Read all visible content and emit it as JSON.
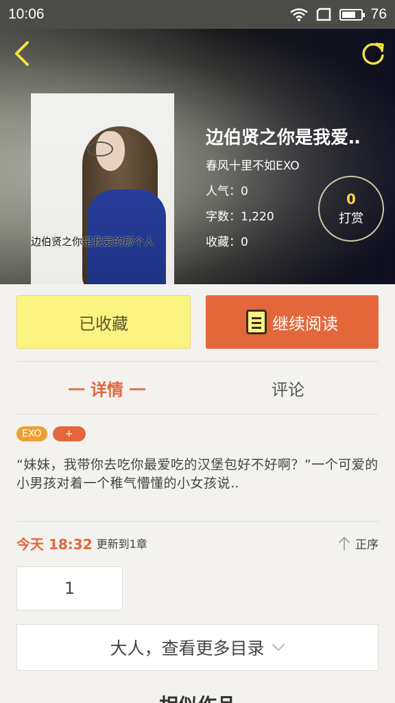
{
  "status_bar": {
    "time": "10:06",
    "battery": "76"
  },
  "hero": {
    "cover_text": "边伯贤之你是我爱的那个人",
    "title": "边伯贤之你是我爱‥",
    "author": "春风十里不如EXO",
    "popularity": "人气：0",
    "word_count": "字数：1,220",
    "favorites": "收藏：0",
    "tip_count": "0",
    "tip_label": "打赏"
  },
  "actions": {
    "favorited_label": "已收藏",
    "continue_label": "继续阅读"
  },
  "tabs": {
    "detail": "一 详情 一",
    "comments": "评论"
  },
  "tags": [
    "EXO",
    "+"
  ],
  "description": "“妹妹，我带你去吃你最爱吃的汉堡包好不好啊？”一个可爱的小男孩对着一个稚气懵懂的小女孩说‥",
  "update": {
    "time": "今天 18:32",
    "text": "更新到1章",
    "order_label": "正序"
  },
  "chapter": {
    "number": "1"
  },
  "more_catalog": {
    "label": "大人，查看更多目录"
  },
  "similar": {
    "title": "相似作品"
  },
  "colors": {
    "accent": "#e3673a",
    "favorite_bg": "#fbf481",
    "tag_exo": "#f0a030"
  },
  "icons": [
    "back-arrow-icon",
    "refresh-icon",
    "wifi-icon",
    "sim-icon",
    "battery-icon",
    "book-icon",
    "up-arrow-icon",
    "chevron-down-icon"
  ]
}
